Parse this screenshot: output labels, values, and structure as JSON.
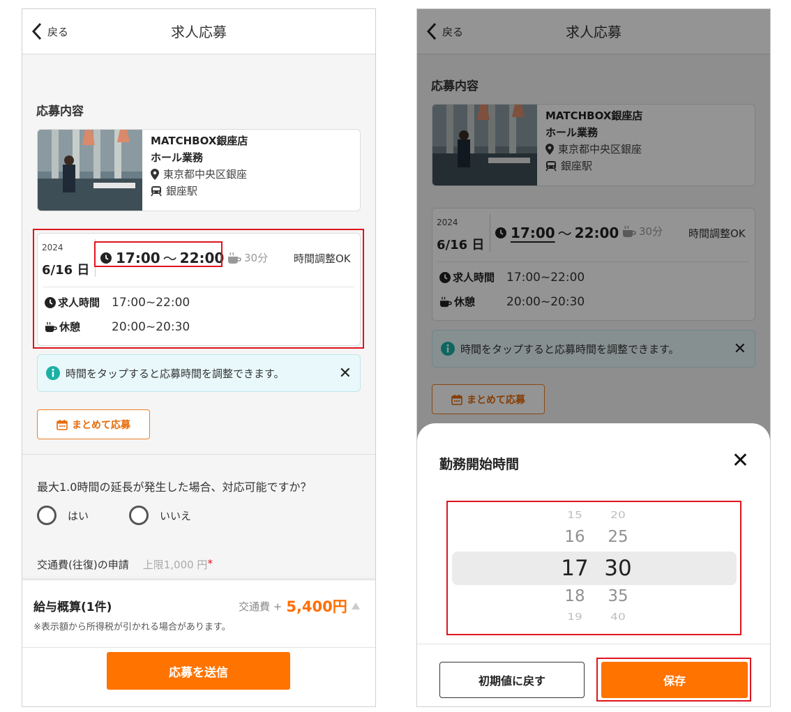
{
  "header": {
    "back_label": "戻る",
    "title": "求人応募"
  },
  "section_title": "応募内容",
  "job": {
    "store": "MATCHBOX銀座店",
    "position": "ホール業務",
    "location": "東京都中央区銀座",
    "station": "銀座駅"
  },
  "shift": {
    "year": "2024",
    "date": "6/16 日",
    "start": "17:00",
    "tilde": "〜",
    "end": "22:00",
    "break_min": "30分",
    "adjustable": "時間調整OK",
    "job_time_label": "求人時間",
    "job_time_value": "17:00~22:00",
    "break_label": "休憩",
    "break_value": "20:00~20:30"
  },
  "info_message": "時間をタップすると応募時間を調整できます。",
  "info_close": "✕",
  "bulk_apply": "まとめて応募",
  "question": "最大1.0時間の延長が発生した場合、対応可能ですか？",
  "options": {
    "yes": "はい",
    "no": "いいえ"
  },
  "transport": {
    "label": "交通費(往復)の申請",
    "limit": "上限1,000 円",
    "required": "*"
  },
  "salary": {
    "label": "給与概算(1件)",
    "transport_plus": "交通費 +",
    "amount": "5,400円",
    "note": "※表示額から所得税が引かれる場合があります。"
  },
  "submit": "応募を送信",
  "sheet": {
    "title": "勤務開始時間",
    "close": "✕",
    "hours": [
      "15",
      "16",
      "17",
      "18",
      "19"
    ],
    "minutes": [
      "20",
      "25",
      "30",
      "35",
      "40"
    ],
    "reset": "初期値に戻す",
    "save": "保存"
  }
}
